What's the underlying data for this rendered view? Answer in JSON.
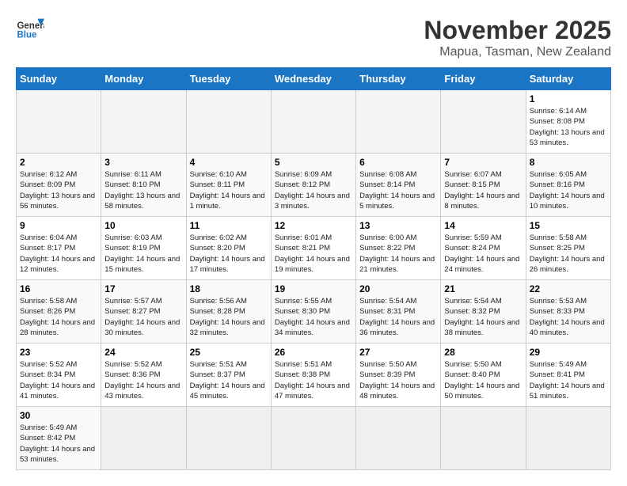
{
  "header": {
    "logo_general": "General",
    "logo_blue": "Blue",
    "month_title": "November 2025",
    "location": "Mapua, Tasman, New Zealand"
  },
  "days_of_week": [
    "Sunday",
    "Monday",
    "Tuesday",
    "Wednesday",
    "Thursday",
    "Friday",
    "Saturday"
  ],
  "weeks": [
    [
      {
        "day": "",
        "info": ""
      },
      {
        "day": "",
        "info": ""
      },
      {
        "day": "",
        "info": ""
      },
      {
        "day": "",
        "info": ""
      },
      {
        "day": "",
        "info": ""
      },
      {
        "day": "",
        "info": ""
      },
      {
        "day": "1",
        "info": "Sunrise: 6:14 AM\nSunset: 8:08 PM\nDaylight: 13 hours and 53 minutes."
      }
    ],
    [
      {
        "day": "2",
        "info": "Sunrise: 6:12 AM\nSunset: 8:09 PM\nDaylight: 13 hours and 56 minutes."
      },
      {
        "day": "3",
        "info": "Sunrise: 6:11 AM\nSunset: 8:10 PM\nDaylight: 13 hours and 58 minutes."
      },
      {
        "day": "4",
        "info": "Sunrise: 6:10 AM\nSunset: 8:11 PM\nDaylight: 14 hours and 1 minute."
      },
      {
        "day": "5",
        "info": "Sunrise: 6:09 AM\nSunset: 8:12 PM\nDaylight: 14 hours and 3 minutes."
      },
      {
        "day": "6",
        "info": "Sunrise: 6:08 AM\nSunset: 8:14 PM\nDaylight: 14 hours and 5 minutes."
      },
      {
        "day": "7",
        "info": "Sunrise: 6:07 AM\nSunset: 8:15 PM\nDaylight: 14 hours and 8 minutes."
      },
      {
        "day": "8",
        "info": "Sunrise: 6:05 AM\nSunset: 8:16 PM\nDaylight: 14 hours and 10 minutes."
      }
    ],
    [
      {
        "day": "9",
        "info": "Sunrise: 6:04 AM\nSunset: 8:17 PM\nDaylight: 14 hours and 12 minutes."
      },
      {
        "day": "10",
        "info": "Sunrise: 6:03 AM\nSunset: 8:19 PM\nDaylight: 14 hours and 15 minutes."
      },
      {
        "day": "11",
        "info": "Sunrise: 6:02 AM\nSunset: 8:20 PM\nDaylight: 14 hours and 17 minutes."
      },
      {
        "day": "12",
        "info": "Sunrise: 6:01 AM\nSunset: 8:21 PM\nDaylight: 14 hours and 19 minutes."
      },
      {
        "day": "13",
        "info": "Sunrise: 6:00 AM\nSunset: 8:22 PM\nDaylight: 14 hours and 21 minutes."
      },
      {
        "day": "14",
        "info": "Sunrise: 5:59 AM\nSunset: 8:24 PM\nDaylight: 14 hours and 24 minutes."
      },
      {
        "day": "15",
        "info": "Sunrise: 5:58 AM\nSunset: 8:25 PM\nDaylight: 14 hours and 26 minutes."
      }
    ],
    [
      {
        "day": "16",
        "info": "Sunrise: 5:58 AM\nSunset: 8:26 PM\nDaylight: 14 hours and 28 minutes."
      },
      {
        "day": "17",
        "info": "Sunrise: 5:57 AM\nSunset: 8:27 PM\nDaylight: 14 hours and 30 minutes."
      },
      {
        "day": "18",
        "info": "Sunrise: 5:56 AM\nSunset: 8:28 PM\nDaylight: 14 hours and 32 minutes."
      },
      {
        "day": "19",
        "info": "Sunrise: 5:55 AM\nSunset: 8:30 PM\nDaylight: 14 hours and 34 minutes."
      },
      {
        "day": "20",
        "info": "Sunrise: 5:54 AM\nSunset: 8:31 PM\nDaylight: 14 hours and 36 minutes."
      },
      {
        "day": "21",
        "info": "Sunrise: 5:54 AM\nSunset: 8:32 PM\nDaylight: 14 hours and 38 minutes."
      },
      {
        "day": "22",
        "info": "Sunrise: 5:53 AM\nSunset: 8:33 PM\nDaylight: 14 hours and 40 minutes."
      }
    ],
    [
      {
        "day": "23",
        "info": "Sunrise: 5:52 AM\nSunset: 8:34 PM\nDaylight: 14 hours and 41 minutes."
      },
      {
        "day": "24",
        "info": "Sunrise: 5:52 AM\nSunset: 8:36 PM\nDaylight: 14 hours and 43 minutes."
      },
      {
        "day": "25",
        "info": "Sunrise: 5:51 AM\nSunset: 8:37 PM\nDaylight: 14 hours and 45 minutes."
      },
      {
        "day": "26",
        "info": "Sunrise: 5:51 AM\nSunset: 8:38 PM\nDaylight: 14 hours and 47 minutes."
      },
      {
        "day": "27",
        "info": "Sunrise: 5:50 AM\nSunset: 8:39 PM\nDaylight: 14 hours and 48 minutes."
      },
      {
        "day": "28",
        "info": "Sunrise: 5:50 AM\nSunset: 8:40 PM\nDaylight: 14 hours and 50 minutes."
      },
      {
        "day": "29",
        "info": "Sunrise: 5:49 AM\nSunset: 8:41 PM\nDaylight: 14 hours and 51 minutes."
      }
    ],
    [
      {
        "day": "30",
        "info": "Sunrise: 5:49 AM\nSunset: 8:42 PM\nDaylight: 14 hours and 53 minutes."
      },
      {
        "day": "",
        "info": ""
      },
      {
        "day": "",
        "info": ""
      },
      {
        "day": "",
        "info": ""
      },
      {
        "day": "",
        "info": ""
      },
      {
        "day": "",
        "info": ""
      },
      {
        "day": "",
        "info": ""
      }
    ]
  ]
}
